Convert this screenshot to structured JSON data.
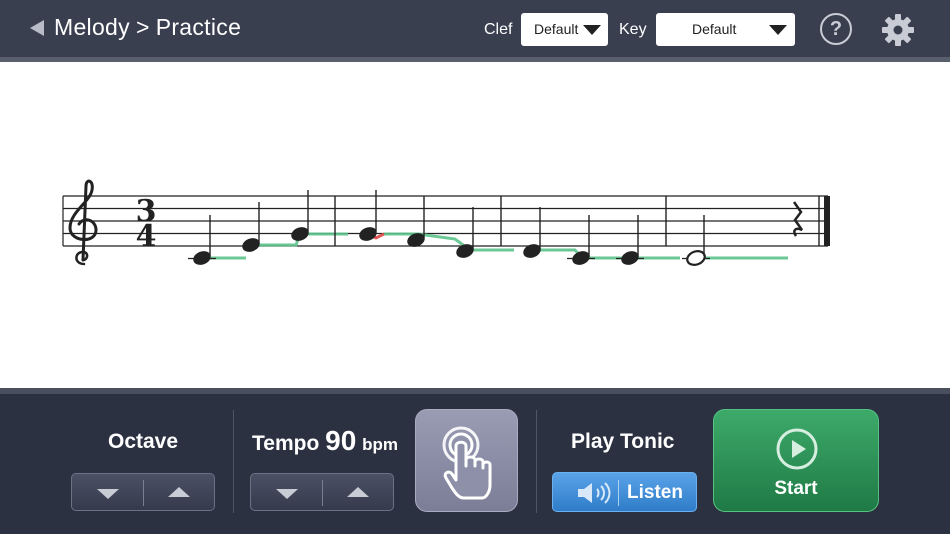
{
  "header": {
    "breadcrumb": [
      "Melody",
      "Practice"
    ],
    "breadcrumb_separator": ">",
    "clef_label": "Clef",
    "clef_value": "Default",
    "key_label": "Key",
    "key_value": "Default",
    "help_symbol": "?"
  },
  "score": {
    "time_signature": {
      "top": "3",
      "bottom": "4"
    }
  },
  "controls": {
    "octave_label": "Octave",
    "tempo_label": "Tempo",
    "tempo_value": "90",
    "tempo_unit": "bpm",
    "play_tonic_label": "Play Tonic",
    "listen_label": "Listen",
    "start_label": "Start"
  },
  "colors": {
    "topbar": "#3a3f50",
    "panel": "#2c3142",
    "pitch_trace_good": "#5cc28a",
    "pitch_trace_bad": "#e25555",
    "listen_blue": "#2f7cc8",
    "start_green": "#1f7a45"
  },
  "icons": {
    "back": "back-icon",
    "help": "help-icon",
    "settings": "gear-icon",
    "touch": "touch-icon",
    "speaker": "speaker-icon",
    "play": "play-icon"
  }
}
